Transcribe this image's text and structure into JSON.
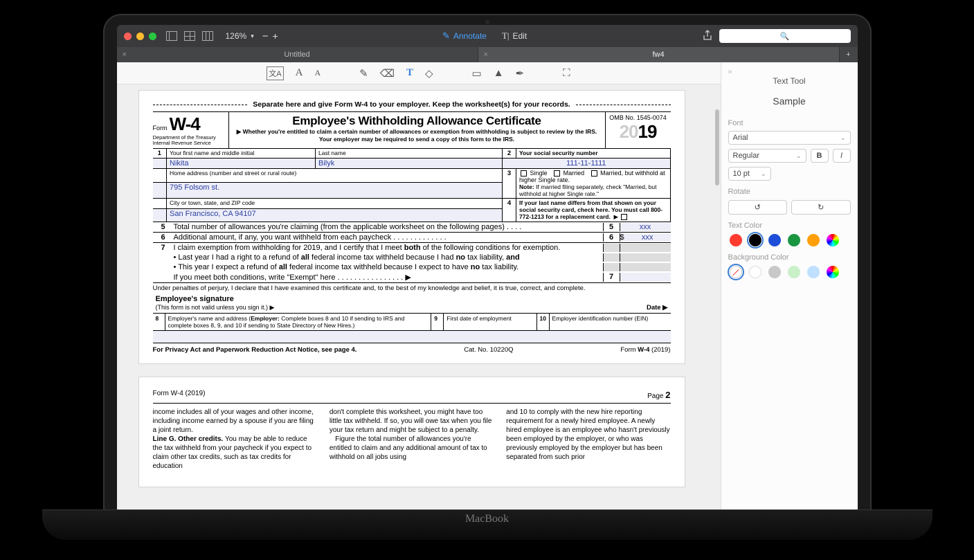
{
  "titlebar": {
    "zoom": "126%",
    "modes": {
      "annotate": "Annotate",
      "edit": "Edit"
    }
  },
  "search": {
    "placeholder": ""
  },
  "tabs": [
    {
      "name": "Untitled",
      "active": false
    },
    {
      "name": "fw4",
      "active": true
    }
  ],
  "sidebar": {
    "title": "Text Tool",
    "sample": "Sample",
    "sections": {
      "font": "Font",
      "rotate": "Rotate",
      "textColor": "Text Color",
      "bgColor": "Background Color"
    },
    "font": {
      "family": "Arial",
      "style": "Regular",
      "size": "10 pt",
      "bold": "B",
      "italic": "I"
    },
    "textColors": [
      "#ff3b30",
      "#000000",
      "#1e4ed8",
      "#1a9641",
      "#ff9f0a",
      "multi"
    ],
    "textColorSelected": 1,
    "bgColors": [
      "none",
      "#ffffff",
      "#d0d0d0",
      "#c9f0c9",
      "#bfe0ff",
      "multi"
    ],
    "bgColorSelected": 0
  },
  "form": {
    "separatorText": "Separate here and give Form W-4 to your employer. Keep the worksheet(s) for your records.",
    "formLabel": "Form",
    "formCode": "W-4",
    "dept1": "Department of the Treasury",
    "dept2": "Internal Revenue Service",
    "title": "Employee's Withholding Allowance Certificate",
    "subtitle": "▶ Whether you're entitled to claim a certain number of allowances or exemption from withholding is subject to review by the IRS. Your employer may be required to send a copy of this form to the IRS.",
    "omb": "OMB No. 1545-0074",
    "year": "2019",
    "row1": {
      "num": "1",
      "label": "Your first name and middle initial",
      "val": "Nikita",
      "lastLabel": "Last name",
      "lastVal": "Bilyk",
      "ssnNum": "2",
      "ssnLabel": "Your social security number",
      "ssnVal": "111-11-1111"
    },
    "row2": {
      "label": "Home address (number and street or rural route)",
      "val": "795 Folsom st.",
      "num": "3",
      "single": "Single",
      "married": "Married",
      "marriedHigh": "Married, but withhold at higher Single rate.",
      "note": "Note: If married filing separately, check \"Married, but withhold at higher Single rate.\""
    },
    "row3": {
      "label": "City or town, state, and ZIP code",
      "val": "San Francisco, CA 94107",
      "num": "4",
      "text": "If your last name differs from that shown on your social security card, check here. You must call 800-772-1213 for a replacement card."
    },
    "line5": {
      "n": "5",
      "t": "Total number of allowances you're claiming (from the applicable worksheet on the following pages)  .   .   .   .",
      "box": "5",
      "val": "xxx"
    },
    "line6": {
      "n": "6",
      "t": "Additional amount, if any, you want withheld from each paycheck   .   .   .   .   .   .   .   .   .   .   .   .   .",
      "box": "6",
      "prefix": "$",
      "val": "xxx"
    },
    "line7": {
      "n": "7",
      "a": "I claim exemption from withholding for 2019, and I certify that I meet ",
      "aBold": "both",
      "a2": " of the following conditions for exemption.",
      "b": "• Last year I had a right to a refund of ",
      "bBold": "all",
      "b2": " federal income tax withheld because I had ",
      "bBold2": "no",
      "b3": " tax liability, ",
      "bBold3": "and",
      "c": "• This year I expect a refund of ",
      "cBold": "all",
      "c2": " federal income tax withheld because I expect to have ",
      "cBold2": "no",
      "c3": " tax liability.",
      "d": "If you meet both conditions, write \"Exempt\" here  .   .   .   .   .   .   .   .   .   .   .   .   .   .   .   .   ▶",
      "box": "7"
    },
    "perjury": "Under penalties of perjury, I declare that I have examined this certificate and, to the best of my knowledge and belief, it is true, correct, and complete.",
    "sigLabel": "Employee's signature",
    "sigNote": "(This form is not valid unless you sign it.) ▶",
    "dateLabel": "Date ▶",
    "row8": {
      "n": "8",
      "text": "Employer's name and address (",
      "bold": "Employer:",
      "text2": " Complete boxes 8 and 10 if sending to IRS and complete boxes 8, 9, and 10 if sending to State Directory of New Hires.)"
    },
    "row9": {
      "n": "9",
      "text": "First date of employment"
    },
    "row10": {
      "n": "10",
      "text": "Employer identification number (EIN)"
    },
    "footerL": "For Privacy Act and Paperwork Reduction Act Notice, see page 4.",
    "footerC": "Cat. No. 10220Q",
    "footerR1": "Form ",
    "footerR2": "W-4",
    "footerR3": " (2019)"
  },
  "page2": {
    "headL": "Form W-4 (2019)",
    "headR": "Page ",
    "headRn": "2",
    "col1a": "income includes all of your wages and other income, including income earned by a spouse if you are filing a joint return.",
    "col1bLabel": "Line G. Other credits. ",
    "col1b": "You may be able to reduce the tax withheld from your paycheck if you expect to claim other tax credits, such as tax credits for education",
    "col2": "don't complete this worksheet, you might have too little tax withheld. If so, you will owe tax when you file your tax return and might be subject to a penalty.",
    "col2b": "Figure the total number of allowances you're entitled to claim and any additional amount of tax to withhold on all jobs using",
    "col3": "and 10 to comply with the new hire reporting requirement for a newly hired employee. A newly hired employee is an employee who hasn't previously been employed by the employer, or who was previously employed by the employer but has been separated from such prior"
  },
  "macbook": "MacBook"
}
